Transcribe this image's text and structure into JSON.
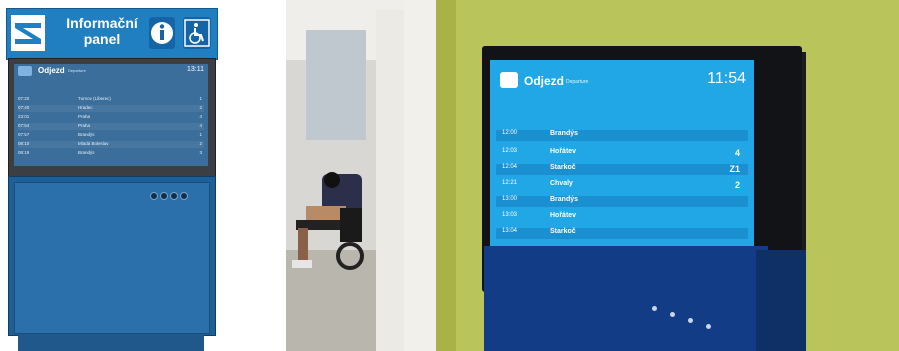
{
  "kiosk": {
    "title_line1": "Informační",
    "title_line2": "panel",
    "info_icon": "info-icon",
    "wheelchair_icon": "wheelchair-icon",
    "screen_title": "Odjezd",
    "screen_subtitle": "Departure",
    "screen_clock": "13:11",
    "rows": [
      {
        "time": "07:20",
        "dest": "Turnov (Liberec)",
        "platform": "1"
      },
      {
        "time": "07:40",
        "dest": "Hradec",
        "platform": "2"
      },
      {
        "time": "23:01",
        "dest": "Praha",
        "platform": "4"
      },
      {
        "time": "07:54",
        "dest": "Praha",
        "platform": "4"
      },
      {
        "time": "07:57",
        "dest": "Brandýs",
        "platform": "1"
      },
      {
        "time": "08:10",
        "dest": "Mladá Boleslav",
        "platform": "2"
      },
      {
        "time": "08:19",
        "dest": "Brandýs",
        "platform": "3"
      }
    ]
  },
  "photo": {
    "screen_title": "Odjezd",
    "screen_subtitle": "Departure",
    "screen_clock": "11:54",
    "rows": [
      {
        "time": "12:00",
        "dest": "Brandýs",
        "platform": ""
      },
      {
        "time": "12:03",
        "dest": "Hořátev",
        "platform": "4"
      },
      {
        "time": "12:04",
        "dest": "Starkoč",
        "platform": "Z1"
      },
      {
        "time": "12:21",
        "dest": "Chvaly",
        "platform": "2"
      },
      {
        "time": "13:00",
        "dest": "Brandýs",
        "platform": ""
      },
      {
        "time": "13:03",
        "dest": "Hořátev",
        "platform": ""
      },
      {
        "time": "13:04",
        "dest": "Starkoč",
        "platform": ""
      }
    ]
  }
}
